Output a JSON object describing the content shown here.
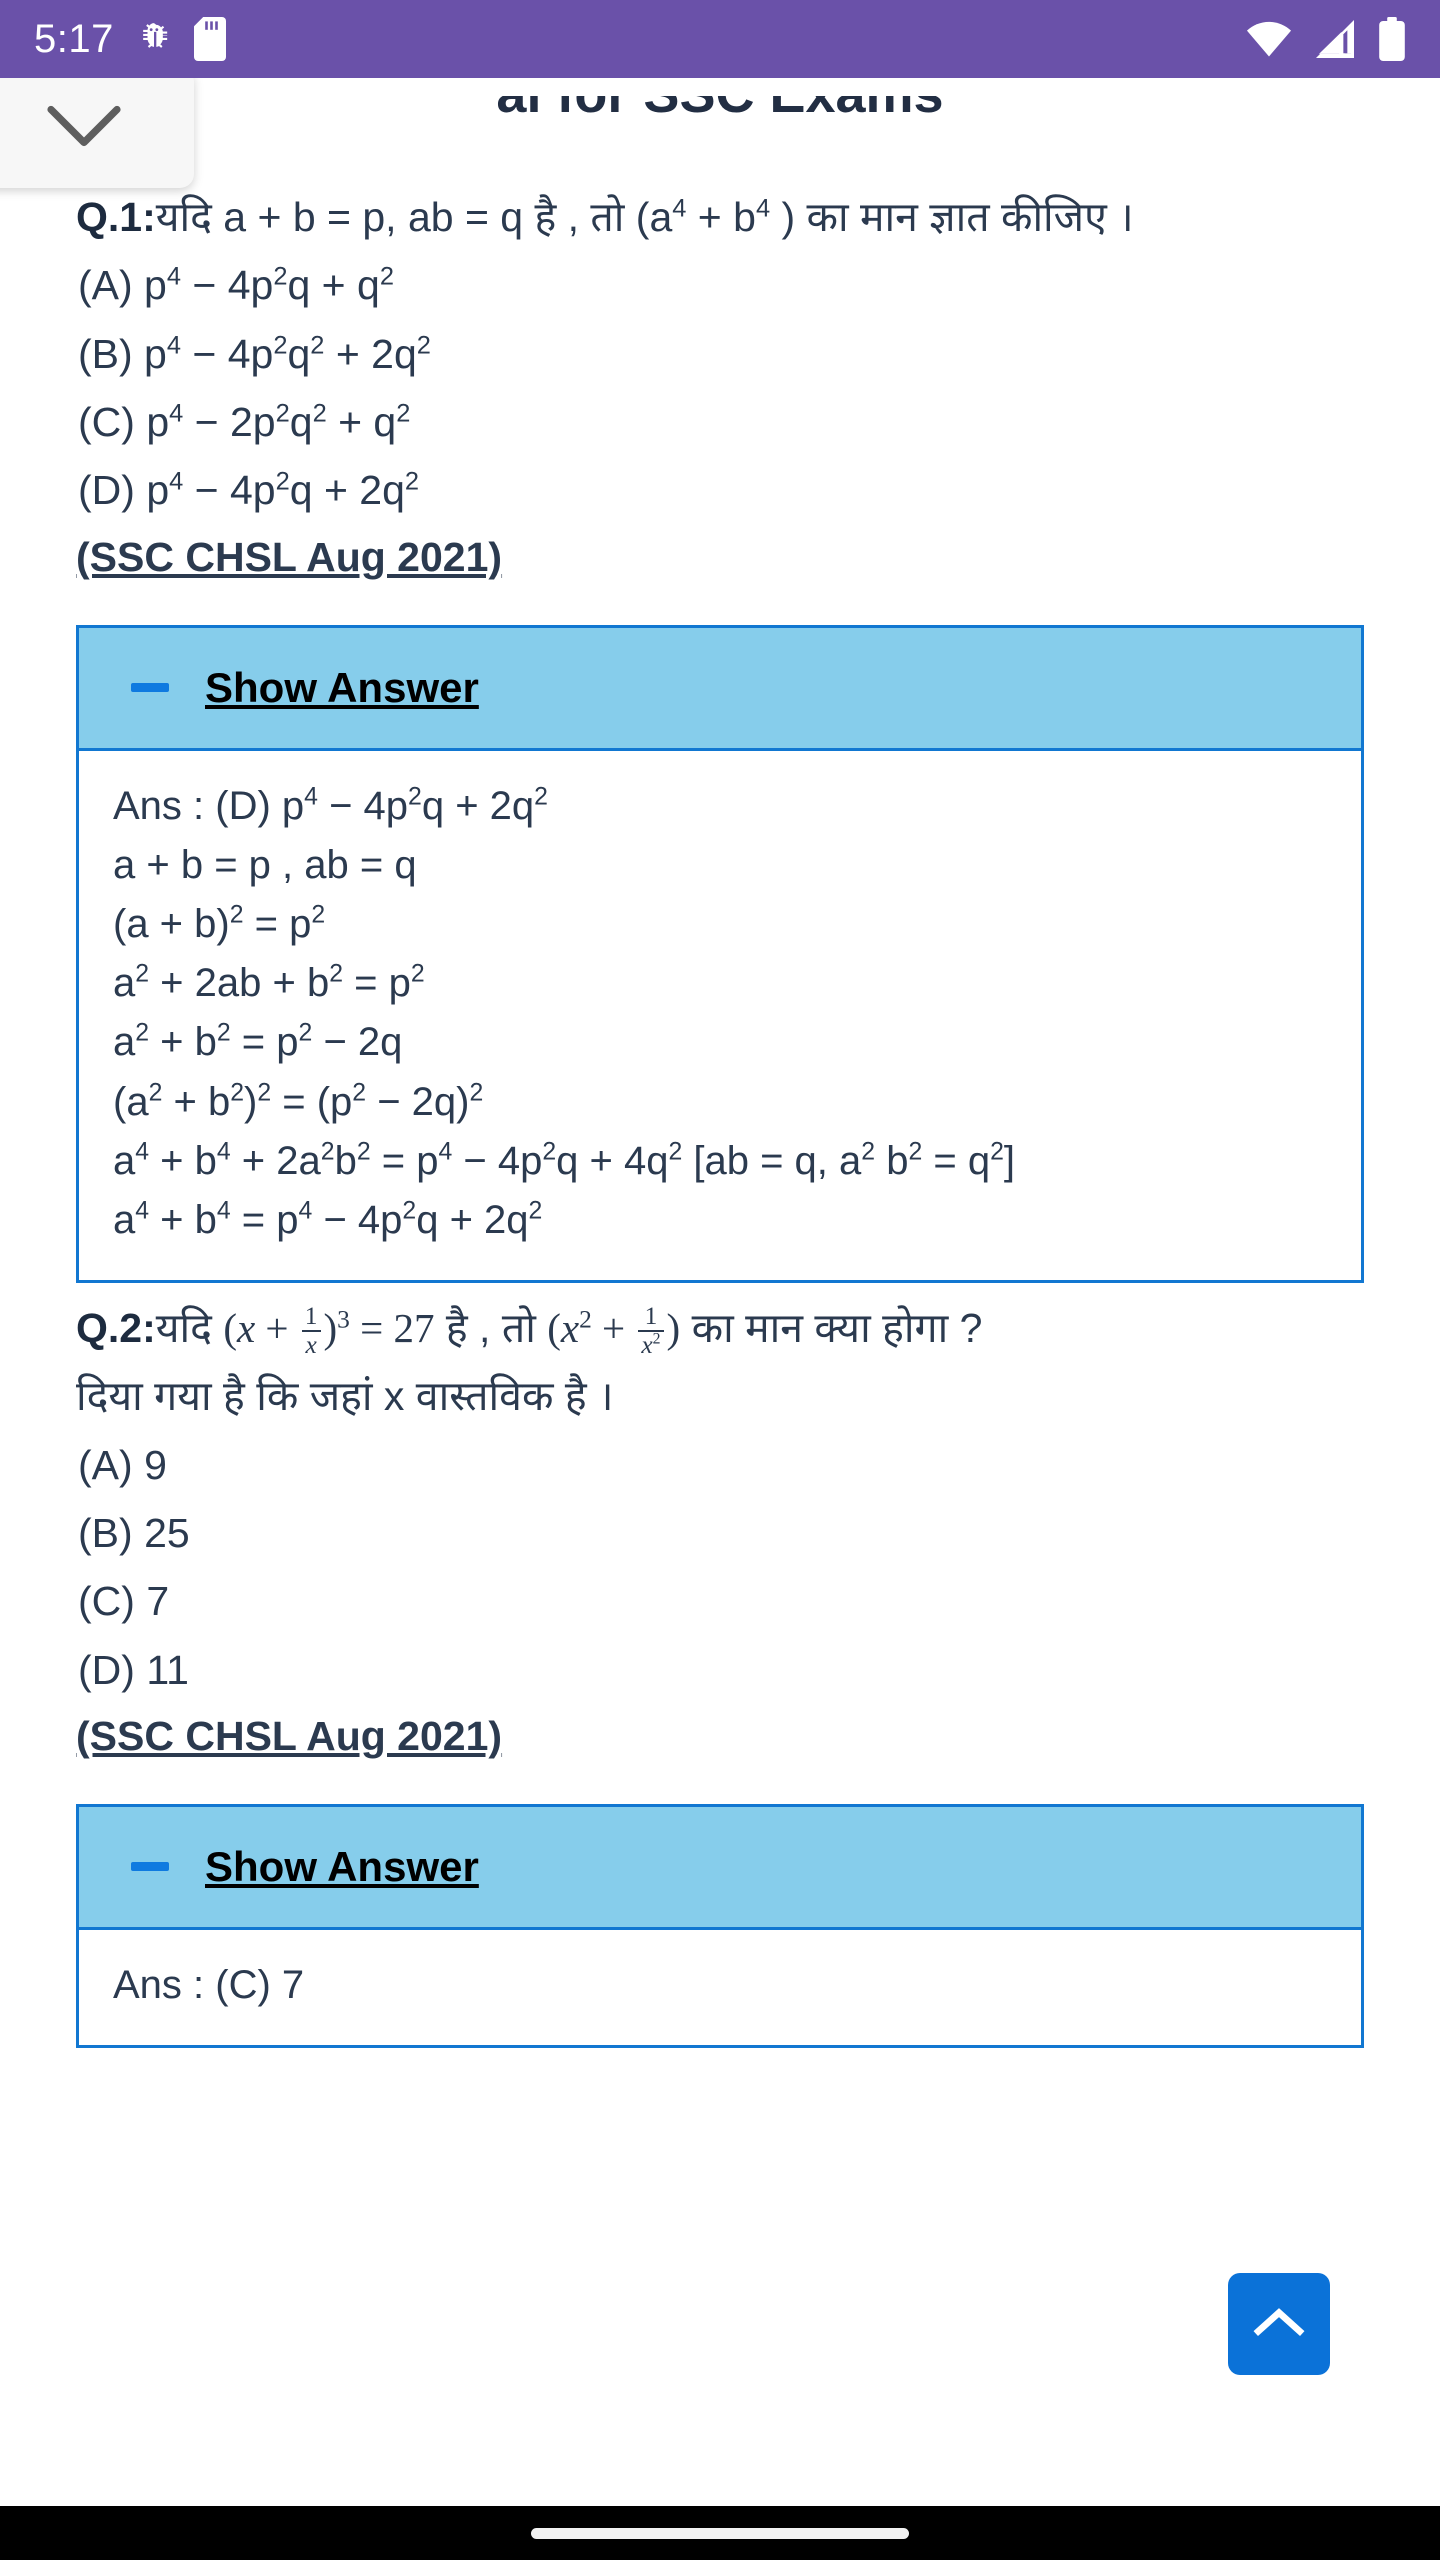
{
  "statusbar": {
    "time": "5:17",
    "icons": [
      "bug-icon",
      "sd-card-icon",
      "wifi-icon",
      "cellular-signal-icon",
      "battery-icon"
    ],
    "background": "#6a51a9"
  },
  "header": {
    "cut_title": "al for SSC Exams",
    "collapse_icon": "chevron-down-icon"
  },
  "questions": [
    {
      "number": "Q.1:",
      "prompt_prefix": "यदि a + b = p, ab = q है , तो (a",
      "prompt_sup1": "4",
      "prompt_mid": " + b",
      "prompt_sup2": "4",
      "prompt_suffix": " ) का मान ज्ञात कीजिए ।",
      "options": [
        {
          "label": "(A)",
          "text": "p4 − 4p2q + q2"
        },
        {
          "label": "(B)",
          "text": "p4 − 4p2q2 + 2q2"
        },
        {
          "label": "(C)",
          "text": "p4 − 2p2q2 + q2"
        },
        {
          "label": "(D)",
          "text": "p4 − 4p2q + 2q2"
        }
      ],
      "source": "(SSC CHSL Aug 2021)",
      "answer": {
        "toggle_label": "Show Answer",
        "toggle_icon": "minus-icon",
        "lines": [
          "Ans : (D) p4 − 4p2q + 2q2",
          "a + b = p , ab = q",
          "(a + b)2 = p2",
          "a2 + 2ab + b2 = p2",
          "a2 + b2 = p2 − 2q",
          "(a2 + b2)2 = (p2 − 2q)2",
          "a4 + b4 + 2a2b2 = p4 − 4p2q + 4q2 [ab = q, a2 b2 = q2]",
          "a4 + b4 = p4 − 4p2q + 2q2"
        ]
      }
    },
    {
      "number": "Q.2:",
      "prompt_line1_a": "यदि ",
      "prompt_math1": "(x + 1/x)3 = 27",
      "prompt_line1_b": " है , तो ",
      "prompt_math2": "(x2 + 1/x2)",
      "prompt_line1_c": " का मान क्या होगा ?",
      "prompt_line2": "दिया गया है कि जहां x वास्तविक है ।",
      "options": [
        {
          "label": "(A)",
          "text": "9"
        },
        {
          "label": "(B)",
          "text": "25"
        },
        {
          "label": "(C)",
          "text": "7"
        },
        {
          "label": "(D)",
          "text": "11"
        }
      ],
      "source": "(SSC CHSL Aug 2021)",
      "answer": {
        "toggle_label": "Show Answer",
        "toggle_icon": "minus-icon",
        "lines": [
          "Ans : (C) 7"
        ]
      }
    }
  ],
  "scroll_to_top": {
    "icon": "chevron-up-icon",
    "color": "#0b72d8"
  },
  "navbar": {
    "gesture_pill": "home-gesture-pill"
  },
  "colors": {
    "status_purple": "#6a51a9",
    "accordion_header": "#86cdeb",
    "accordion_border": "#1177d1",
    "text": "#2b3a4f",
    "accent_blue": "#0b72d8"
  }
}
